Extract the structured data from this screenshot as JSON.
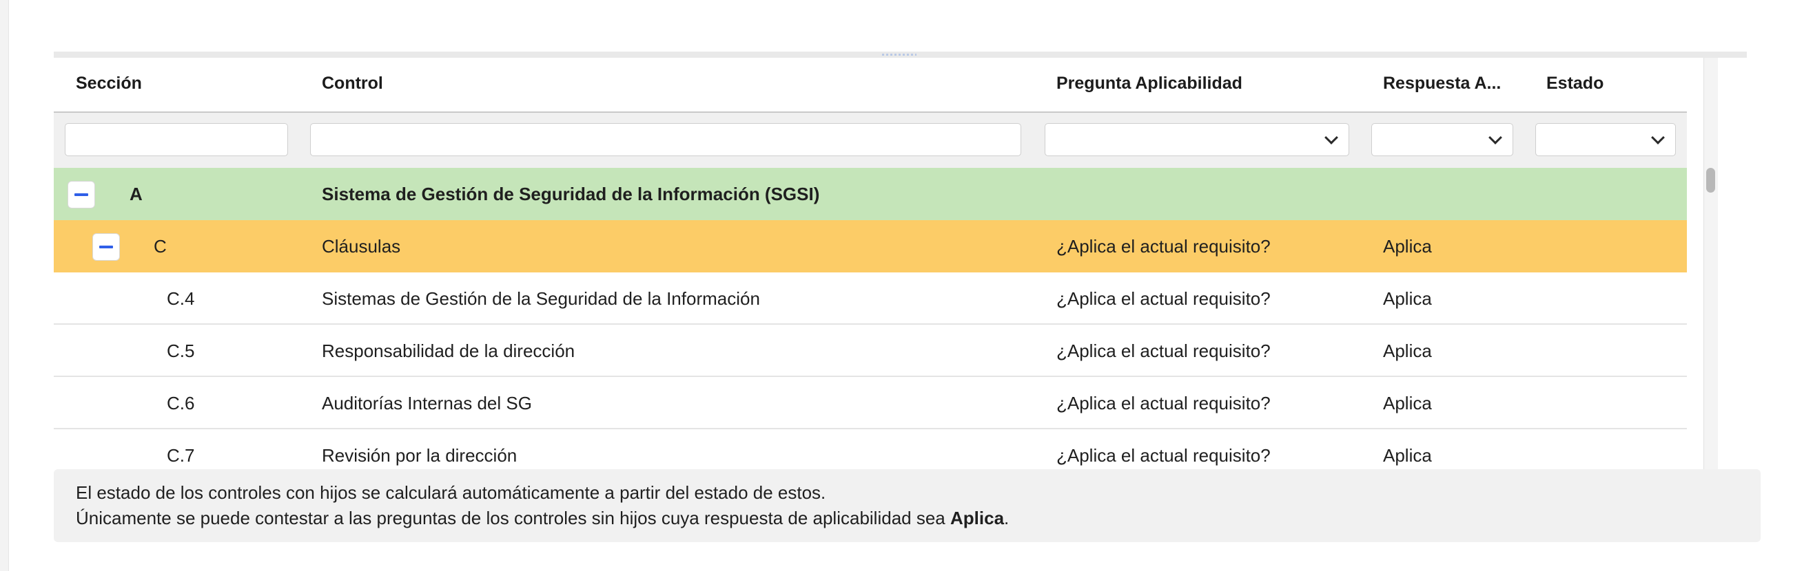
{
  "grid": {
    "columns": [
      {
        "key": "seccion",
        "label": "Sección"
      },
      {
        "key": "control",
        "label": "Control"
      },
      {
        "key": "pregunta",
        "label": "Pregunta Aplicabilidad"
      },
      {
        "key": "respuesta",
        "label": "Respuesta A..."
      },
      {
        "key": "estado",
        "label": "Estado"
      }
    ],
    "filters": {
      "seccion_value": "",
      "control_value": "",
      "pregunta_selected": "",
      "respuesta_selected": "",
      "estado_selected": ""
    },
    "rows": [
      {
        "type": "group",
        "level": 0,
        "expanded": true,
        "seccion": "A",
        "control": "Sistema de Gestión de Seguridad de la Información (SGSI)",
        "pregunta": "",
        "respuesta": "",
        "estado": ""
      },
      {
        "type": "group",
        "level": 1,
        "expanded": true,
        "seccion": "C",
        "control": "Cláusulas",
        "pregunta": "¿Aplica el actual requisito?",
        "respuesta": "Aplica",
        "estado": ""
      },
      {
        "type": "leaf",
        "seccion": "C.4",
        "control": "Sistemas de Gestión de la Seguridad de la Información",
        "pregunta": "¿Aplica el actual requisito?",
        "respuesta": "Aplica",
        "estado": ""
      },
      {
        "type": "leaf",
        "seccion": "C.5",
        "control": "Responsabilidad de la dirección",
        "pregunta": "¿Aplica el actual requisito?",
        "respuesta": "Aplica",
        "estado": ""
      },
      {
        "type": "leaf",
        "seccion": "C.6",
        "control": "Auditorías Internas del SG",
        "pregunta": "¿Aplica el actual requisito?",
        "respuesta": "Aplica",
        "estado": ""
      },
      {
        "type": "leaf",
        "seccion": "C.7",
        "control": "Revisión por la dirección",
        "pregunta": "¿Aplica el actual requisito?",
        "respuesta": "Aplica",
        "estado": ""
      }
    ]
  },
  "note": {
    "line1": "El estado de los controles con hijos se calculará automáticamente a partir del estado de estos.",
    "line2_prefix": "Únicamente se puede contestar a las preguntas de los controles sin hijos cuya respuesta de aplicabilidad sea ",
    "line2_bold": "Aplica",
    "line2_suffix": "."
  },
  "colors": {
    "group_level0_bg": "#c5e5b9",
    "group_level1_bg": "#fccc67",
    "toggle_accent": "#2f5fe8"
  },
  "icons": {
    "collapse": "minus-icon",
    "dropdown": "chevron-down-icon"
  }
}
